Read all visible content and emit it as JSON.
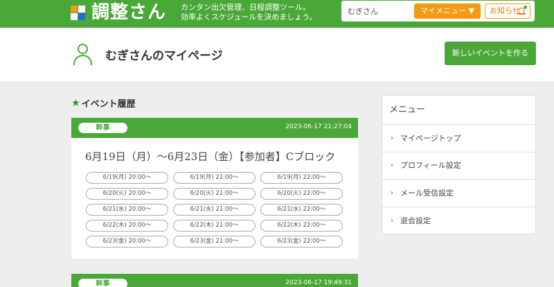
{
  "header": {
    "app_name": "調整さん",
    "tagline_line1": "カンタン出欠管理、日程調整ツール。",
    "tagline_line2": "効率よくスケジュールを決めましょう。",
    "username": "むぎさん",
    "mymenu_label": "マイメニュー ▼",
    "notice_label": "お知らせ"
  },
  "page": {
    "title": "むぎさんのマイページ",
    "new_event_label": "新しいイベントを作る"
  },
  "history": {
    "heading": "イベント履歴",
    "cards": [
      {
        "role": "幹事",
        "timestamp": "2023-06-17 21:27:04",
        "title": "6月19日（月）～6月23日（金）【参加者】Cブロック",
        "slots": [
          "6/19(月) 20:00～",
          "6/19(月) 21:00～",
          "6/19(月) 22:00～",
          "6/20(火) 20:00～",
          "6/20(火) 21:00～",
          "6/20(火) 22:00～",
          "6/21(水) 20:00～",
          "6/21(水) 21:00～",
          "6/21(水) 22:00～",
          "6/22(木) 20:00～",
          "6/22(木) 21:00～",
          "6/22(木) 22:00～",
          "6/23(金) 20:00～",
          "6/23(金) 21:00～",
          "6/23(金) 22:00～"
        ]
      },
      {
        "role": "幹事",
        "timestamp": "2023-06-17 19:49:31"
      }
    ]
  },
  "menu": {
    "title": "メニュー",
    "items": [
      "マイページトップ",
      "プロフィール設定",
      "メール受信設定",
      "退会設定"
    ]
  },
  "colors": {
    "brand_green": "#4aa838",
    "accent_orange": "#f39a12"
  },
  "icons": {
    "star": "★",
    "chevron": "›"
  }
}
